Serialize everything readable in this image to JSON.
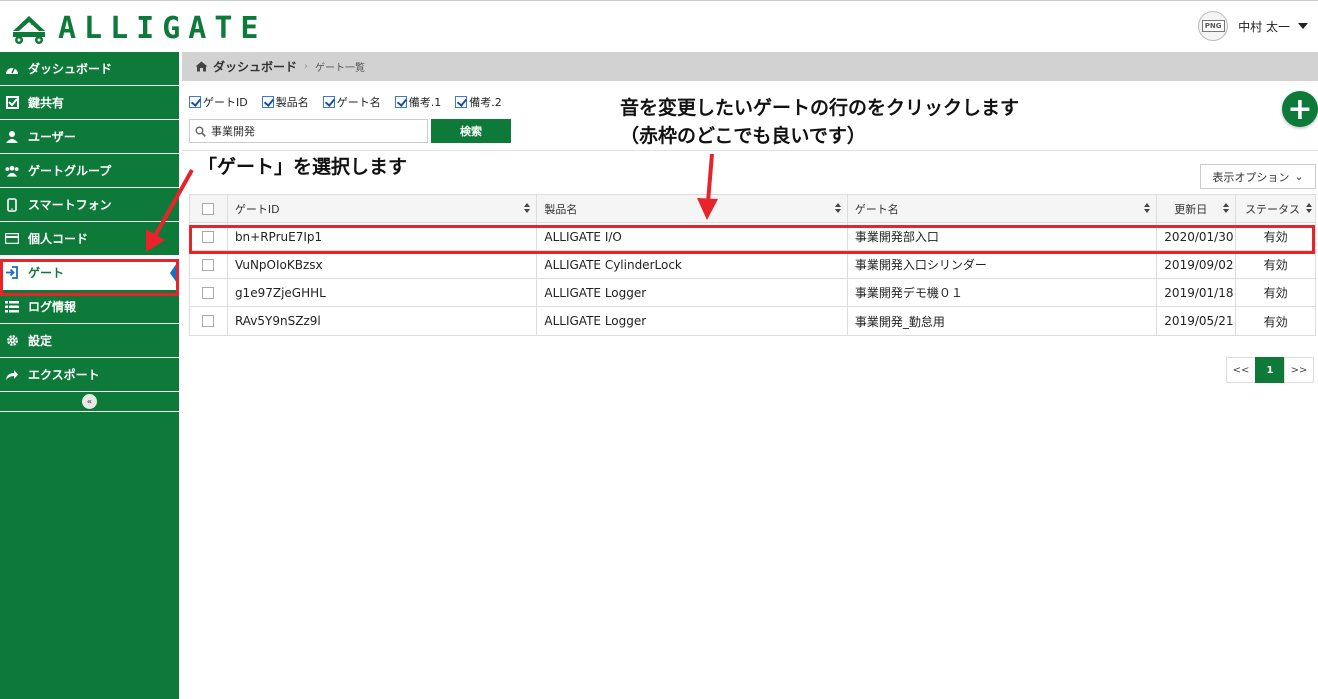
{
  "app": {
    "logo_text": "ALLIGATE"
  },
  "header": {
    "user_name": "中村 太一",
    "avatar_label": "PNG"
  },
  "sidebar": {
    "items": [
      {
        "label": "ダッシュボード",
        "icon": "dashboard-icon"
      },
      {
        "label": "鍵共有",
        "icon": "check-square-icon"
      },
      {
        "label": "ユーザー",
        "icon": "user-icon"
      },
      {
        "label": "ゲートグループ",
        "icon": "users-icon"
      },
      {
        "label": "スマートフォン",
        "icon": "smartphone-icon"
      },
      {
        "label": "個人コード",
        "icon": "credit-card-icon"
      },
      {
        "label": "ゲート",
        "icon": "sign-in-icon",
        "active": true
      },
      {
        "label": "ログ情報",
        "icon": "list-icon"
      },
      {
        "label": "設定",
        "icon": "gear-icon"
      },
      {
        "label": "エクスポート",
        "icon": "share-icon"
      }
    ],
    "collapse_label": "«"
  },
  "breadcrumb": {
    "home": "ダッシュボード",
    "separator": "›",
    "current": "ゲート一覧"
  },
  "filters": {
    "columns": [
      {
        "label": "ゲートID",
        "checked": true
      },
      {
        "label": "製品名",
        "checked": true
      },
      {
        "label": "ゲート名",
        "checked": true
      },
      {
        "label": "備考.1",
        "checked": true
      },
      {
        "label": "備考.2",
        "checked": true
      }
    ],
    "search_value": "事業開発",
    "search_button": "検索",
    "add_button": "+"
  },
  "display_options": {
    "label": "表示オプション",
    "chevron": "⌄"
  },
  "table": {
    "headers": [
      "ゲートID",
      "製品名",
      "ゲート名",
      "更新日",
      "ステータス"
    ],
    "rows": [
      [
        "bn+RPruE7Ip1",
        "ALLIGATE I/O",
        "事業開発部入口",
        "2020/01/30",
        "有効"
      ],
      [
        "VuNpOIoKBzsx",
        "ALLIGATE CylinderLock",
        "事業開発入口シリンダー",
        "2019/09/02",
        "有効"
      ],
      [
        "g1e97ZjeGHHL",
        "ALLIGATE Logger",
        "事業開発デモ機０１",
        "2019/01/18",
        "有効"
      ],
      [
        "RAv5Y9nSZz9l",
        "ALLIGATE Logger",
        "事業開発_勤怠用",
        "2019/05/21",
        "有効"
      ]
    ]
  },
  "pagination": {
    "prev": "<<",
    "current": "1",
    "next": ">>"
  },
  "annotations": {
    "note_select_gate": "「ゲート」を選択します",
    "note_click_row_line1": "音を変更したいゲートの行のをクリックします",
    "note_click_row_line2": "（赤枠のどこでも良いです）"
  },
  "colors": {
    "brand_green": "#0e7a3a",
    "annotation_red": "#e8242a",
    "active_marker": "#1a6fc0"
  }
}
